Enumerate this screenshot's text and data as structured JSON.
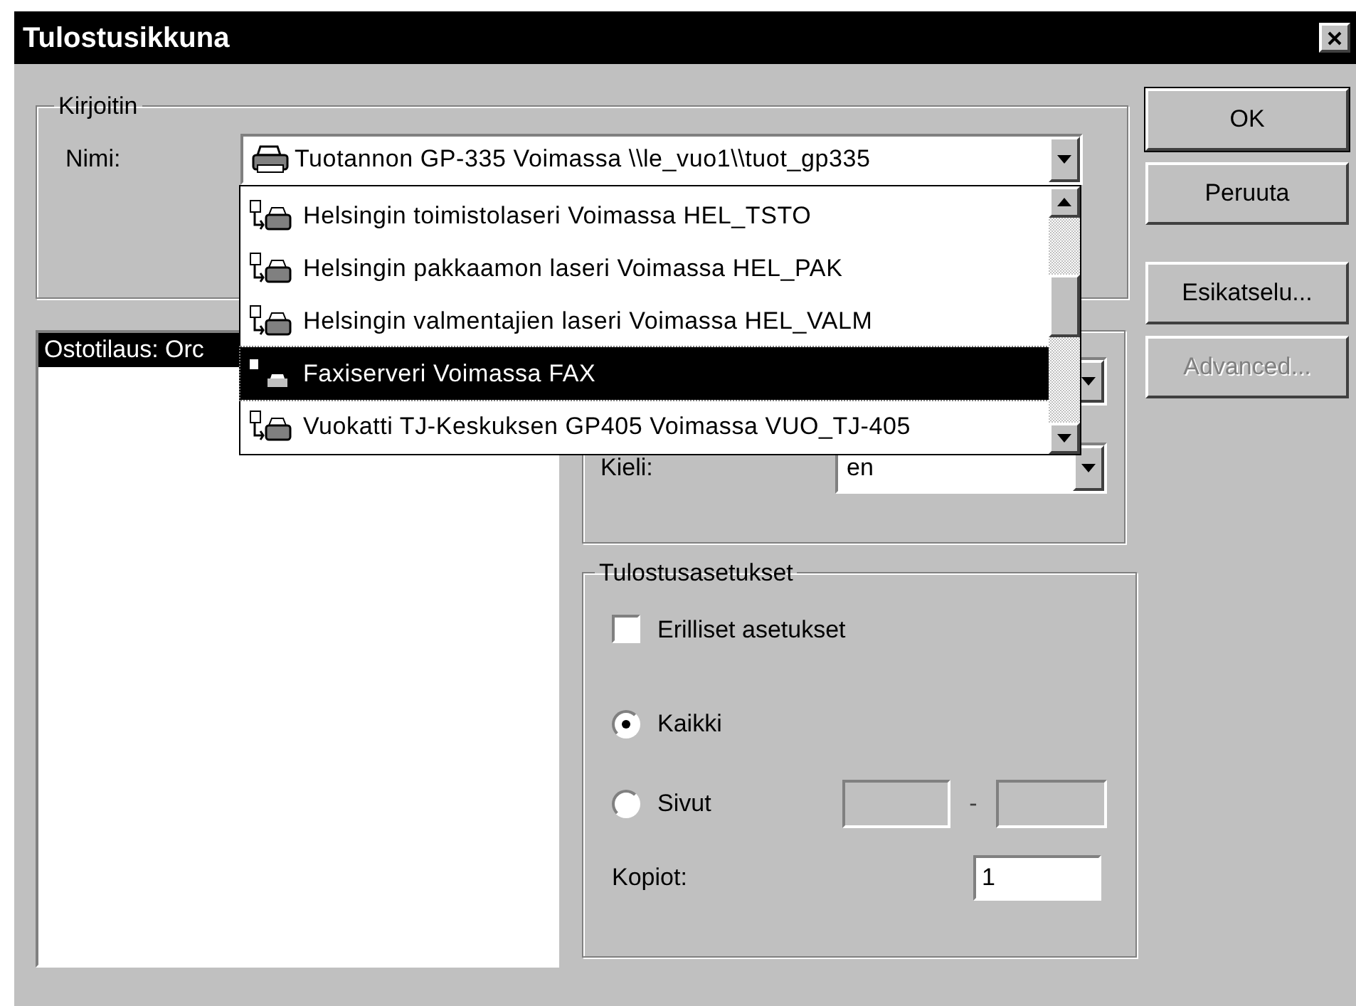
{
  "window": {
    "title": "Tulostusikkuna"
  },
  "printer_group": {
    "legend": "Kirjoitin",
    "name_label": "Nimi:",
    "selected_printer": "Tuotannon GP-335 Voimassa \\\\le_vuo1\\\\tuot_gp335",
    "dropdown": {
      "expanded": true,
      "items": [
        {
          "kind": "network_printer",
          "label": "Helsingin toimistolaseri Voimassa HEL_TSTO",
          "selected": false
        },
        {
          "kind": "network_printer",
          "label": "Helsingin pakkaamon laseri Voimassa HEL_PAK",
          "selected": false
        },
        {
          "kind": "network_printer",
          "label": "Helsingin valmentajien laseri Voimassa HEL_VALM",
          "selected": false
        },
        {
          "kind": "fax",
          "label": "Faxiserveri Voimassa FAX",
          "selected": true
        },
        {
          "kind": "network_printer",
          "label": "Vuokatti TJ-Keskuksen GP405 Voimassa VUO_TJ-405",
          "selected": false
        }
      ]
    }
  },
  "document_list": {
    "header": "Ostotilaus: Orc"
  },
  "language": {
    "label": "Kieli:",
    "value": "en"
  },
  "print_settings": {
    "legend": "Tulostusasetukset",
    "separate_settings": {
      "label": "Erilliset asetukset",
      "checked": false
    },
    "range_options": [
      {
        "label": "Kaikki",
        "selected": true
      },
      {
        "label": "Sivut",
        "selected": false
      }
    ],
    "page_separator": "-",
    "page_fields_disabled": true,
    "copies": {
      "label": "Kopiot:",
      "value": "1"
    }
  },
  "buttons": [
    {
      "label": "OK",
      "default": true,
      "disabled": false
    },
    {
      "label": "Peruuta",
      "default": false,
      "disabled": false
    },
    {
      "label": "Esikatselu...",
      "default": false,
      "disabled": false
    },
    {
      "label": "Advanced...",
      "default": false,
      "disabled": true
    }
  ]
}
